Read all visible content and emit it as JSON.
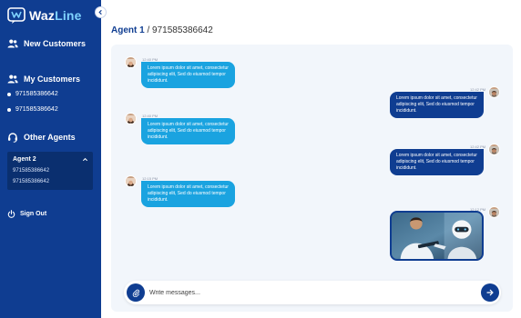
{
  "brand": {
    "name_part1": "Waz",
    "name_part2": "Line",
    "icon": "wazline-logo-icon"
  },
  "sidebar": {
    "new_customers": {
      "label": "New Customers",
      "icon": "users-icon"
    },
    "my_customers": {
      "label": "My Customers",
      "icon": "users-icon",
      "items": [
        "971585386642",
        "971585386642"
      ]
    },
    "other_agents": {
      "label": "Other Agents",
      "icon": "headset-icon",
      "agent": {
        "name": "Agent 2",
        "numbers": [
          "971585386642",
          "971585386642"
        ]
      }
    },
    "sign_out": {
      "label": "Sign Out",
      "icon": "power-icon"
    }
  },
  "header": {
    "agent": "Agent 1",
    "separator": " / ",
    "number": "971585386642"
  },
  "messages": [
    {
      "side": "left",
      "time": "12:40 PM",
      "text": "Lorem ipsum dolor sit amet, consectetur adipiscing elit, Sed do eiusmod tempor incididunt."
    },
    {
      "side": "right",
      "time": "12:42 PM",
      "text": "Lorem ipsum dolor sit amet, consectetur adipiscing elit, Sed do eiusmod tempor incididunt."
    },
    {
      "side": "left",
      "time": "12:40 PM",
      "text": "Lorem ipsum dolor sit amet, consectetur adipiscing elit, Sed do eiusmod tempor incididunt."
    },
    {
      "side": "right",
      "time": "12:42 PM",
      "text": "Lorem ipsum dolor sit amet, consectetur adipiscing elit, Sed do eiusmod tempor incididunt."
    },
    {
      "side": "left",
      "time": "12:15 PM",
      "text": "Lorem ipsum dolor sit amet, consectetur adipiscing elit, Sed do eiusmod tempor incididunt."
    },
    {
      "side": "right",
      "time": "12:12 PM",
      "type": "image",
      "image": "man-and-robot-photo"
    }
  ],
  "composer": {
    "placeholder": "Write messages...",
    "attach_icon": "paperclip-icon",
    "send_icon": "arrow-right-icon"
  },
  "colors": {
    "primary": "#0f3d91",
    "accent": "#1aa3e0",
    "chat_bg": "#f2f6fb"
  }
}
